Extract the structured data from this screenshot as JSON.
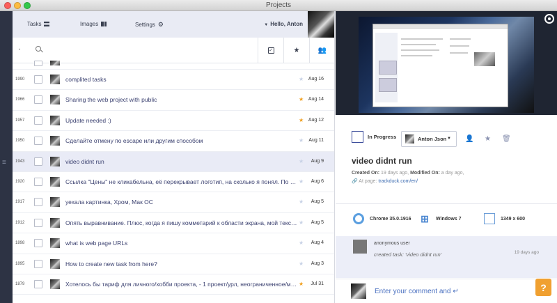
{
  "window": {
    "title": "Projects"
  },
  "nav": {
    "tasks": "Tasks",
    "images": "Images",
    "settings": "Settings",
    "greeting": "Hello, Anton"
  },
  "search": {
    "placeholder": ""
  },
  "tasks": [
    {
      "id": "1990",
      "text": "complited tasks",
      "starred": false,
      "date": "Aug 16"
    },
    {
      "id": "1966",
      "text": "Sharing the web project with public",
      "starred": true,
      "date": "Aug 14"
    },
    {
      "id": "1957",
      "text": "Update needed :)",
      "starred": true,
      "date": "Aug 12"
    },
    {
      "id": "1950",
      "text": "Сделайте отмену по escape или другим способом",
      "starred": false,
      "date": "Aug 11"
    },
    {
      "id": "1943",
      "text": "video didnt run",
      "starred": false,
      "date": "Aug 9",
      "selected": true
    },
    {
      "id": "1920",
      "text": "Ссылка \"Цены\" не кликабельна, её перекрывает логотип, на сколько я понял. По сущ...",
      "starred": false,
      "date": "Aug 6"
    },
    {
      "id": "1917",
      "text": "уехала картинка, Хром, Мак ОС",
      "starred": false,
      "date": "Aug 5"
    },
    {
      "id": "1912",
      "text": "Опять выравнивание. Плюс, когда я пишу комметарий к области экрана, мой текст за...",
      "starred": false,
      "date": "Aug 5"
    },
    {
      "id": "1898",
      "text": "what is web page URLs",
      "starred": false,
      "date": "Aug 4"
    },
    {
      "id": "1895",
      "text": "How to create new task from here?",
      "starred": false,
      "date": "Aug 3"
    },
    {
      "id": "1879",
      "text": "Хотелось бы тариф для личного/хобби проекта, - 1 проект/урл, неограниченное/мног...",
      "starred": true,
      "date": "Jul 31"
    }
  ],
  "detail": {
    "status": "In Progress",
    "assignee": "Anton Json",
    "title": "video didnt run",
    "created_label": "Created On:",
    "created_value": "19 days ago",
    "modified_label": "Modified On:",
    "modified_value": "a day ago,",
    "page_label": "At page:",
    "page_url": "trackduck.com/en/",
    "browser": "Chrome 35.0.1916",
    "os": "Windows 7",
    "resolution": "1349 x 600"
  },
  "activity": {
    "user": "anonymous user",
    "text": "created task: 'video didnt run'",
    "time": "19 days ago"
  },
  "comment": {
    "placeholder": "Enter your comment and ↵"
  },
  "help": {
    "label": "?"
  },
  "colors": {
    "accent": "#3a4b9a",
    "star_on": "#f0a020",
    "help": "#f0a030",
    "rail": "#2d3344"
  }
}
